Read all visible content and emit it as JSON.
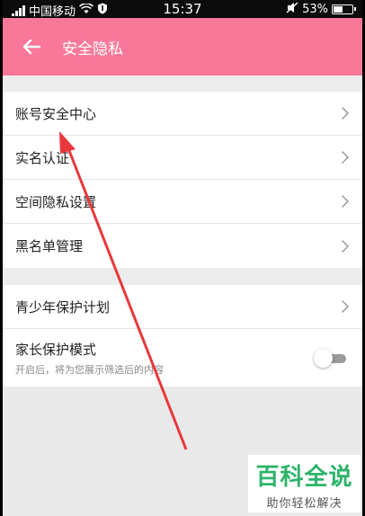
{
  "status_bar": {
    "carrier": "中国移动",
    "time": "15:37",
    "battery": "53%",
    "battery_level": 0.53
  },
  "header": {
    "title": "安全隐私",
    "back_icon": "arrow-left-icon"
  },
  "group1": [
    {
      "label": "账号安全中心"
    },
    {
      "label": "实名认证"
    },
    {
      "label": "空间隐私设置"
    },
    {
      "label": "黑名单管理"
    }
  ],
  "group2": {
    "youth": {
      "label": "青少年保护计划"
    },
    "parent": {
      "label": "家长保护模式",
      "description": "开启后，将为您展示筛选后的内容",
      "enabled": false
    }
  },
  "watermark": {
    "title": "百科全说",
    "subtitle": "助你轻松解决"
  },
  "colors": {
    "accent": "#f9789a",
    "annotation_arrow": "#e8383d",
    "watermark_green": "#2db36a"
  }
}
